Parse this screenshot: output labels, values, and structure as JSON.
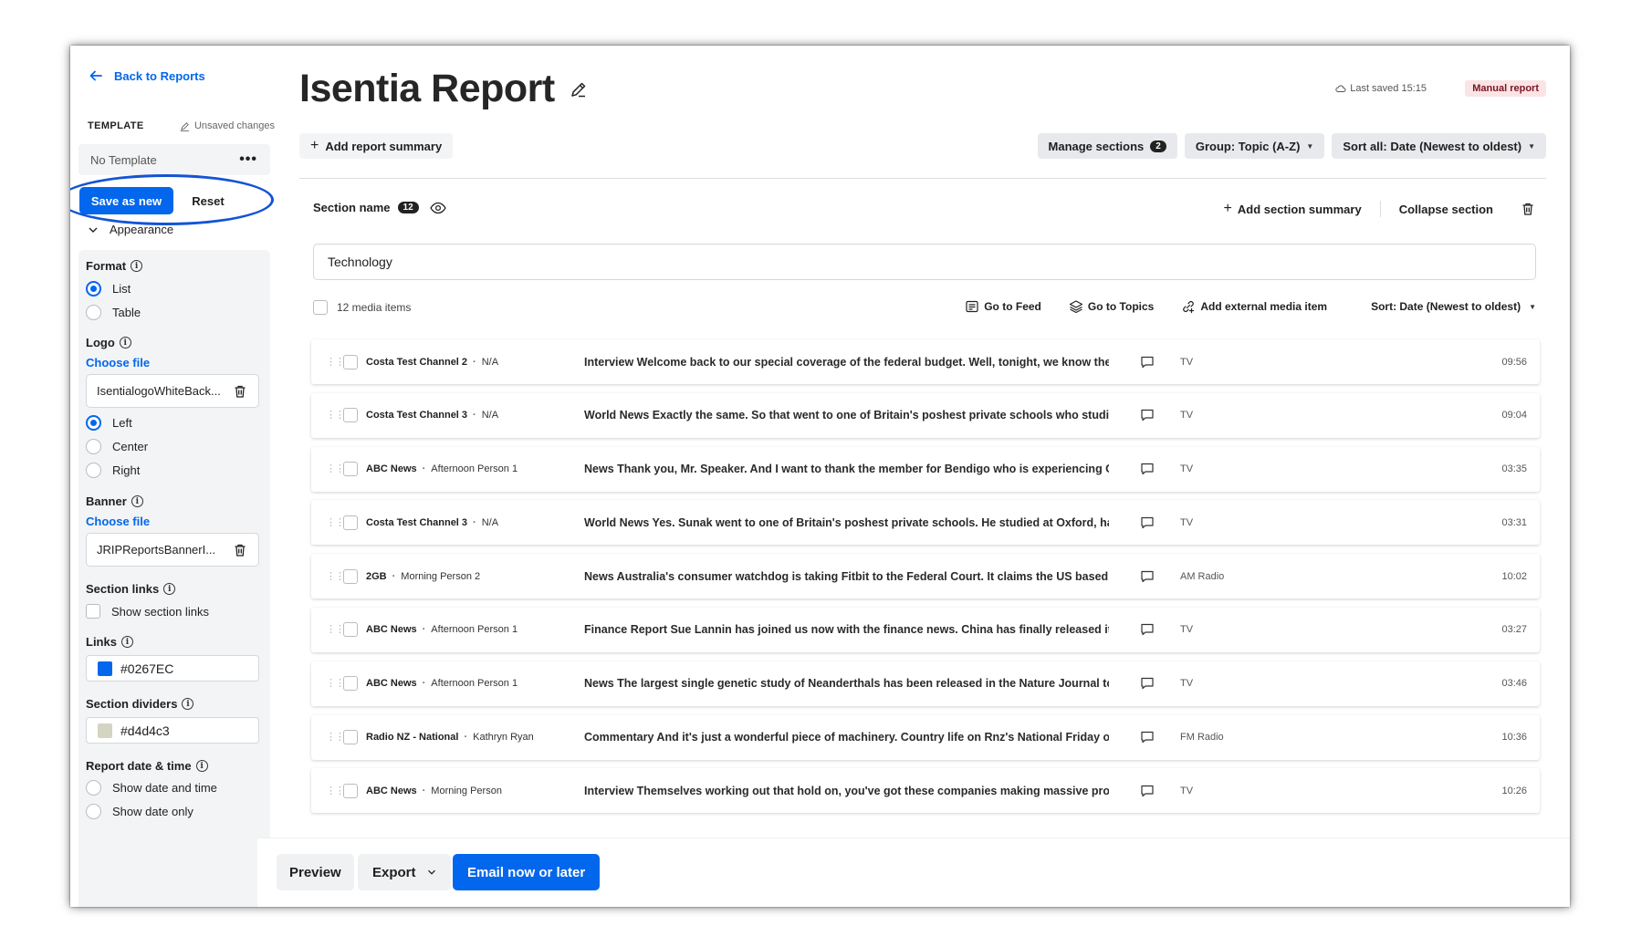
{
  "sidebar": {
    "back_label": "Back to Reports",
    "template_label": "TEMPLATE",
    "unsaved_label": "Unsaved changes",
    "template_value": "No Template",
    "more_label": "•••",
    "save_as_new_label": "Save as new",
    "reset_label": "Reset",
    "appearance_label": "Appearance",
    "format": {
      "label": "Format",
      "options": [
        "List",
        "Table"
      ],
      "selected": "List"
    },
    "logo": {
      "label": "Logo",
      "choose_label": "Choose file",
      "file_name": "IsentialogoWhiteBack...",
      "align_options": [
        "Left",
        "Center",
        "Right"
      ],
      "selected": "Left"
    },
    "banner": {
      "label": "Banner",
      "choose_label": "Choose file",
      "file_name": "JRIPReportsBannerI..."
    },
    "section_links": {
      "label": "Section links",
      "checkbox_label": "Show section links",
      "checked": false
    },
    "links": {
      "label": "Links",
      "color": "#0267EC"
    },
    "section_dividers": {
      "label": "Section dividers",
      "color": "#d4d4c3"
    },
    "report_date": {
      "label": "Report date & time",
      "options": [
        "Show date and time",
        "Show date only"
      ]
    }
  },
  "header": {
    "title": "Isentia Report",
    "last_saved": "Last saved 15:15",
    "badge": "Manual report",
    "add_summary_label": "Add report summary",
    "manage_sections_label": "Manage sections",
    "manage_sections_count": "2",
    "group_label": "Group: Topic (A-Z)",
    "sort_all_label": "Sort all: Date (Newest to oldest)"
  },
  "section": {
    "name_label": "Section name",
    "count": "12",
    "add_section_summary_label": "Add section summary",
    "collapse_label": "Collapse section",
    "name_value": "Technology",
    "media_items_label": "12 media items",
    "go_to_feed_label": "Go to Feed",
    "go_to_topics_label": "Go to Topics",
    "add_external_label": "Add external media item",
    "sort_label": "Sort: Date (Newest to oldest)"
  },
  "items": [
    {
      "channel": "Costa Test Channel 2",
      "person": "N/A",
      "headline": "Interview Welcome back to our special coverage of the federal budget. Well, tonight, we know the nu...",
      "media": "TV",
      "duration": "09:56"
    },
    {
      "channel": "Costa Test Channel 3",
      "person": "N/A",
      "headline": "World News Exactly the same. So that went to one of Britain's poshest private schools who studied at...",
      "media": "TV",
      "duration": "09:04"
    },
    {
      "channel": "ABC News",
      "person": "Afternoon Person 1",
      "headline": "News Thank you, Mr. Speaker. And I want to thank the member for Bendigo who is experiencing Okay, ...",
      "media": "TV",
      "duration": "03:35"
    },
    {
      "channel": "Costa Test Channel 3",
      "person": "N/A",
      "headline": "World News Yes. Sunak went to one of Britain's poshest private schools. He studied at Oxford, had a ...",
      "media": "TV",
      "duration": "03:31"
    },
    {
      "channel": "2GB",
      "person": "Morning Person 2",
      "headline": "News Australia's consumer watchdog is taking Fitbit to the Federal Court. It claims the US based tec...",
      "media": "AM Radio",
      "duration": "10:02"
    },
    {
      "channel": "ABC News",
      "person": "Afternoon Person 1",
      "headline": "Finance Report Sue Lannin has joined us now with the finance news. China has finally released its eco...",
      "media": "TV",
      "duration": "03:27"
    },
    {
      "channel": "ABC News",
      "person": "Afternoon Person 1",
      "headline": "News The largest single genetic study of Neanderthals has been released in the Nature Journal today....",
      "media": "TV",
      "duration": "03:46"
    },
    {
      "channel": "Radio NZ - National",
      "person": "Kathryn Ryan",
      "headline": "Commentary And it's just a wonderful piece of machinery. Country life on Rnz's National Friday of sev...",
      "media": "FM Radio",
      "duration": "10:36"
    },
    {
      "channel": "ABC News",
      "person": "Morning Person",
      "headline": "Interview Themselves working out that hold on, you've got these companies making massive profits, ...",
      "media": "TV",
      "duration": "10:26"
    }
  ],
  "footer": {
    "preview_label": "Preview",
    "export_label": "Export",
    "email_label": "Email now or later"
  },
  "colors": {
    "accent": "#0267EC",
    "badge_bg": "#fbe4e6"
  }
}
